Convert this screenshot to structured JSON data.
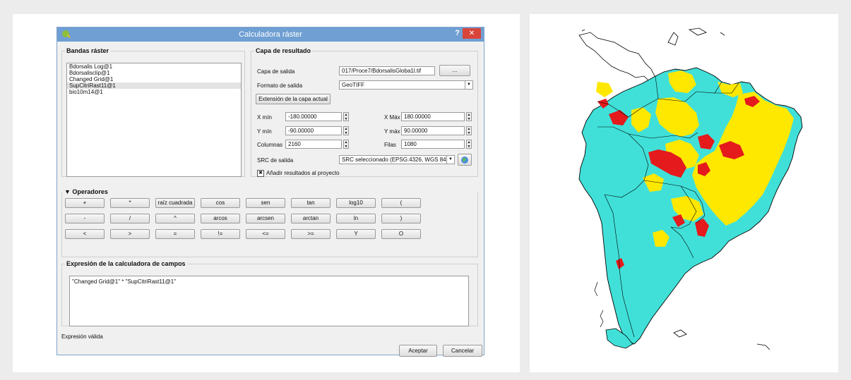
{
  "dialog": {
    "title": "Calculadora ráster",
    "help": "?",
    "close": "✕"
  },
  "bands": {
    "legend": "Bandas ráster",
    "items": [
      "Bdorsalis Log@1",
      "Bdorsalisclip@1",
      "Changed Grid@1",
      "SupCitriRast11@1",
      "bio10m14@1"
    ]
  },
  "result": {
    "legend": "Capa de resultado",
    "output_layer_label": "Capa de salida",
    "output_layer_value": "017/Proce7/BdorsalisGloba1l.tif",
    "browse_label": "...",
    "format_label": "Formato de salida",
    "format_value": "GeoTIFF",
    "extent_button": "Extensión de la capa actual",
    "xmin_label": "X mín",
    "xmin_value": "-180.00000",
    "xmax_label": "X Máx",
    "xmax_value": "180.00000",
    "ymin_label": "Y mín",
    "ymin_value": "-90.00000",
    "ymax_label": "Y máx",
    "ymax_value": "90.00000",
    "columns_label": "Columnas",
    "columns_value": "2160",
    "rows_label": "Filas",
    "rows_value": "1080",
    "crs_label": "SRC de salida",
    "crs_value": "SRC seleccionado (EPSG:4326, WGS 84",
    "add_to_project_label": "Añadir resultados al proyecto",
    "add_to_project_checked": true
  },
  "operators": {
    "legend": "Operadores",
    "rows": [
      [
        "+",
        "*",
        "raíz cuadrada",
        "cos",
        "sen",
        "tan",
        "log10",
        "("
      ],
      [
        "-",
        "/",
        "^",
        "arcos",
        "arcsen",
        "arctan",
        "ln",
        ")"
      ],
      [
        "<",
        ">",
        "=",
        "!=",
        "<=",
        ">=",
        "Y",
        "O"
      ]
    ]
  },
  "expression": {
    "legend": "Expresión de la calculadora de campos",
    "text": "\"Changed Grid@1\" * \"SupCitriRast11@1\"",
    "status": "Expresión válida"
  },
  "buttons": {
    "ok": "Aceptar",
    "cancel": "Cancelar"
  },
  "map": {
    "colors": {
      "low": "#40e0d8",
      "medium": "#ffe800",
      "high": "#e41a1c",
      "outline": "#000000"
    }
  }
}
